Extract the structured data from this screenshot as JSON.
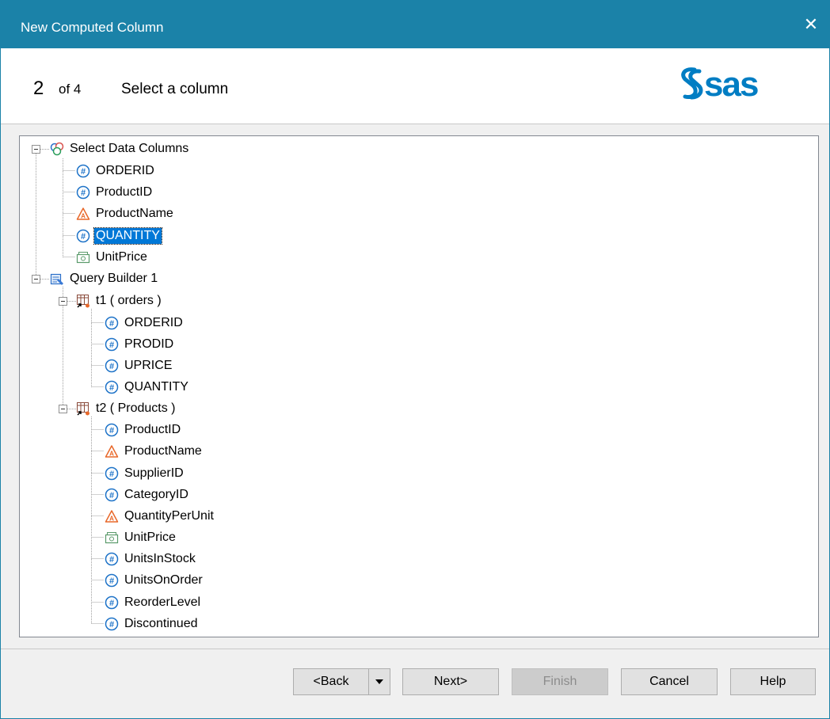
{
  "window": {
    "title": "New Computed Column",
    "close_glyph": "✕"
  },
  "header": {
    "step_number": "2",
    "step_of": "of 4",
    "step_title": "Select a column",
    "logo_text": "sas"
  },
  "tree": {
    "root": "Select Data Columns",
    "select_data_columns": [
      {
        "label": "ORDERID",
        "icon": "numeric-column-icon"
      },
      {
        "label": "ProductID",
        "icon": "numeric-column-icon"
      },
      {
        "label": "ProductName",
        "icon": "character-column-icon"
      },
      {
        "label": "QUANTITY",
        "icon": "numeric-column-icon",
        "selected": true
      },
      {
        "label": "UnitPrice",
        "icon": "currency-column-icon"
      }
    ],
    "query_builder": "Query Builder 1",
    "t1": "t1 ( orders )",
    "t1_columns": [
      {
        "label": "ORDERID",
        "icon": "numeric-column-icon"
      },
      {
        "label": "PRODID",
        "icon": "numeric-column-icon"
      },
      {
        "label": "UPRICE",
        "icon": "numeric-column-icon"
      },
      {
        "label": "QUANTITY",
        "icon": "numeric-column-icon"
      }
    ],
    "t2": "t2 ( Products )",
    "t2_columns": [
      {
        "label": "ProductID",
        "icon": "numeric-column-icon"
      },
      {
        "label": "ProductName",
        "icon": "character-column-icon"
      },
      {
        "label": "SupplierID",
        "icon": "numeric-column-icon"
      },
      {
        "label": "CategoryID",
        "icon": "numeric-column-icon"
      },
      {
        "label": "QuantityPerUnit",
        "icon": "character-column-icon"
      },
      {
        "label": "UnitPrice",
        "icon": "currency-column-icon"
      },
      {
        "label": "UnitsInStock",
        "icon": "numeric-column-icon"
      },
      {
        "label": "UnitsOnOrder",
        "icon": "numeric-column-icon"
      },
      {
        "label": "ReorderLevel",
        "icon": "numeric-column-icon"
      },
      {
        "label": "Discontinued",
        "icon": "numeric-column-icon"
      }
    ]
  },
  "buttons": {
    "back": "<Back",
    "next": "Next>",
    "finish": "Finish",
    "cancel": "Cancel",
    "help": "Help"
  },
  "colors": {
    "titlebar": "#1b82a8",
    "selection": "#0078d7",
    "numeric_icon": "#1e73c8",
    "character_icon": "#e8682a",
    "currency_icon": "#5a9a6a",
    "logo": "#007dc3"
  }
}
